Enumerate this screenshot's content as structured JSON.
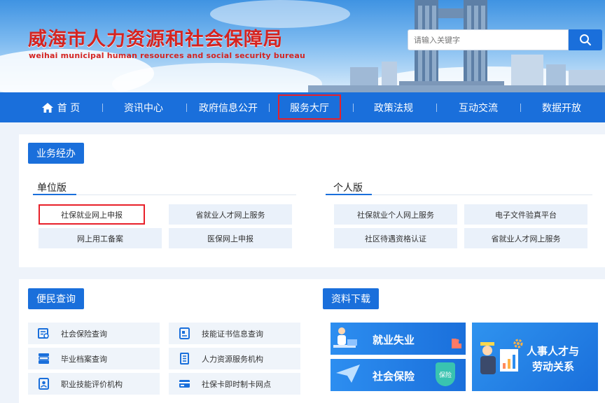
{
  "header": {
    "title": "威海市人力资源和社会保障局",
    "subtitle": "weihai municipal human resources and social security bureau",
    "search": {
      "placeholder": "请输入关键字",
      "icon": "search-icon"
    }
  },
  "nav": {
    "items": [
      {
        "label": "首 页",
        "icon": "home-icon"
      },
      {
        "label": "资讯中心"
      },
      {
        "label": "政府信息公开"
      },
      {
        "label": "服务大厅",
        "highlighted": true
      },
      {
        "label": "政策法规"
      },
      {
        "label": "互动交流"
      },
      {
        "label": "数据开放"
      }
    ]
  },
  "business": {
    "heading": "业务经办",
    "unit": {
      "title": "单位版",
      "items": [
        "社保就业网上申报",
        "省就业人才网上服务",
        "网上用工备案",
        "医保网上申报"
      ]
    },
    "personal": {
      "title": "个人版",
      "items": [
        "社保就业个人网上服务",
        "电子文件验真平台",
        "社区待遇资格认证",
        "省就业人才网上服务"
      ]
    }
  },
  "convenience": {
    "heading": "便民查询",
    "items": [
      {
        "label": "社会保险查询",
        "icon": "insurance-query-icon"
      },
      {
        "label": "技能证书信息查询",
        "icon": "certificate-icon"
      },
      {
        "label": "毕业档案查询",
        "icon": "archive-icon"
      },
      {
        "label": "人力资源服务机构",
        "icon": "document-list-icon"
      },
      {
        "label": "职业技能评价机构",
        "icon": "id-card-icon"
      },
      {
        "label": "社保卡即时制卡网点",
        "icon": "bank-card-icon"
      }
    ]
  },
  "downloads": {
    "heading": "资料下载",
    "cards": [
      {
        "label": "就业失业"
      },
      {
        "label": "社会保险",
        "badge": "保险"
      },
      {
        "label": "人事人才与\n劳动关系",
        "line1": "人事人才与",
        "line2": "劳动关系"
      }
    ]
  },
  "colors": {
    "brand_blue": "#1a6fdb",
    "title_red": "#d42421",
    "highlight_red": "#e8202a",
    "card_blue": "#2a84e6"
  }
}
